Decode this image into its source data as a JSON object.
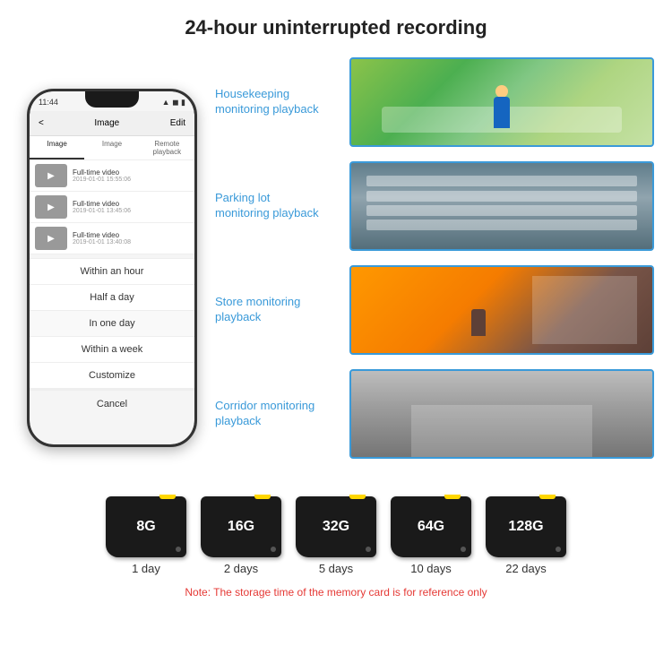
{
  "header": {
    "title": "24-hour uninterrupted recording"
  },
  "phone": {
    "time": "11:44",
    "nav_title": "Image",
    "nav_edit": "Edit",
    "nav_back": "<",
    "tabs": [
      "Image",
      "Image",
      "Remote playback"
    ],
    "list_items": [
      {
        "title": "Full-time video",
        "date": "2019-01-01 15:55:06"
      },
      {
        "title": "Full-time video",
        "date": "2019-01-01 13:45:06"
      },
      {
        "title": "Full-time video",
        "date": "2019-01-01 13:40:08"
      }
    ],
    "dropdown_items": [
      "Within an hour",
      "Half a day",
      "In one day",
      "Within a week",
      "Customize"
    ],
    "cancel_label": "Cancel"
  },
  "monitoring": [
    {
      "label": "Housekeeping\nmonitoring playback",
      "type": "kids"
    },
    {
      "label": "Parking lot\nmonitoring playback",
      "type": "parking"
    },
    {
      "label": "Store monitoring\nplayback",
      "type": "store"
    },
    {
      "label": "Corridor monitoring\nplayback",
      "type": "corridor"
    }
  ],
  "storage": {
    "cards": [
      {
        "size": "8G",
        "days": "1 day"
      },
      {
        "size": "16G",
        "days": "2 days"
      },
      {
        "size": "32G",
        "days": "5 days"
      },
      {
        "size": "64G",
        "days": "10 days"
      },
      {
        "size": "128G",
        "days": "22 days"
      }
    ],
    "note": "Note: The storage time of the memory card is for reference only"
  }
}
